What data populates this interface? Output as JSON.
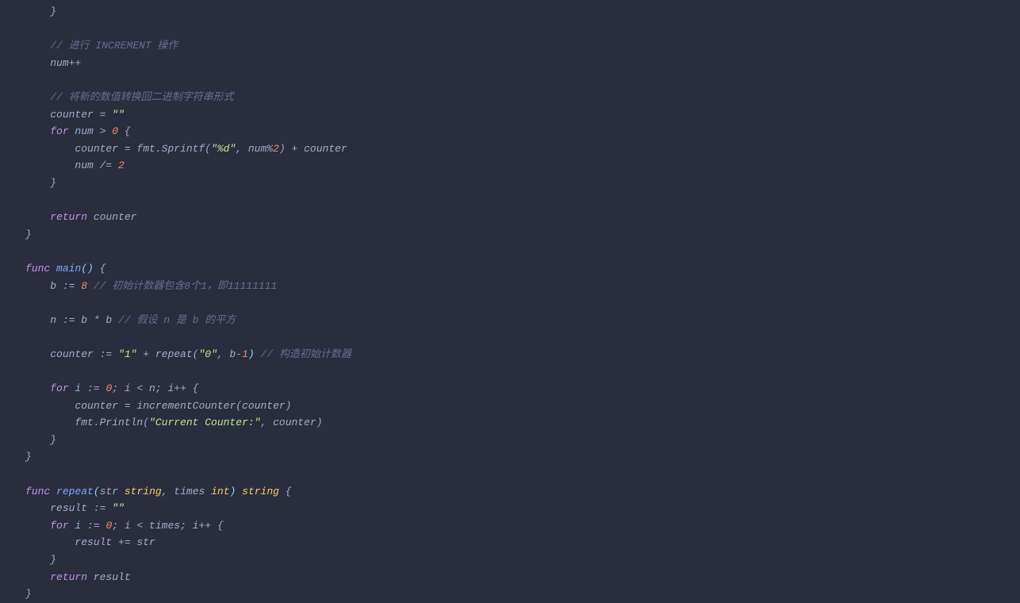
{
  "lines": [
    {
      "indent": 1,
      "tokens": [
        {
          "t": "}",
          "c": "default"
        }
      ]
    },
    {
      "indent": 0,
      "tokens": []
    },
    {
      "indent": 1,
      "tokens": [
        {
          "t": "// 进行 INCREMENT 操作",
          "c": "comment"
        }
      ]
    },
    {
      "indent": 1,
      "tokens": [
        {
          "t": "num++",
          "c": "default"
        }
      ]
    },
    {
      "indent": 0,
      "tokens": []
    },
    {
      "indent": 1,
      "tokens": [
        {
          "t": "// 将新的数值转换回二进制字符串形式",
          "c": "comment"
        }
      ]
    },
    {
      "indent": 1,
      "tokens": [
        {
          "t": "counter = ",
          "c": "default"
        },
        {
          "t": "\"\"",
          "c": "string"
        }
      ]
    },
    {
      "indent": 1,
      "tokens": [
        {
          "t": "for",
          "c": "keyword"
        },
        {
          "t": " num > ",
          "c": "default"
        },
        {
          "t": "0",
          "c": "number"
        },
        {
          "t": " {",
          "c": "default"
        }
      ]
    },
    {
      "indent": 2,
      "tokens": [
        {
          "t": "counter = fmt.Sprintf(",
          "c": "default"
        },
        {
          "t": "\"%d\"",
          "c": "string"
        },
        {
          "t": ", num%",
          "c": "default"
        },
        {
          "t": "2",
          "c": "number"
        },
        {
          "t": ") + counter",
          "c": "default"
        }
      ]
    },
    {
      "indent": 2,
      "tokens": [
        {
          "t": "num /= ",
          "c": "default"
        },
        {
          "t": "2",
          "c": "number"
        }
      ]
    },
    {
      "indent": 1,
      "tokens": [
        {
          "t": "}",
          "c": "default"
        }
      ]
    },
    {
      "indent": 0,
      "tokens": []
    },
    {
      "indent": 1,
      "tokens": [
        {
          "t": "return",
          "c": "keyword"
        },
        {
          "t": " counter",
          "c": "default"
        }
      ]
    },
    {
      "indent": 0,
      "tokens": [
        {
          "t": "}",
          "c": "default"
        }
      ]
    },
    {
      "indent": 0,
      "tokens": []
    },
    {
      "indent": 0,
      "tokens": [
        {
          "t": "func",
          "c": "keyword"
        },
        {
          "t": " ",
          "c": "default"
        },
        {
          "t": "main",
          "c": "funcdecl"
        },
        {
          "t": "()",
          "c": "paren"
        },
        {
          "t": " {",
          "c": "default"
        }
      ]
    },
    {
      "indent": 1,
      "tokens": [
        {
          "t": "b := ",
          "c": "default"
        },
        {
          "t": "8",
          "c": "number"
        },
        {
          "t": " ",
          "c": "default"
        },
        {
          "t": "// 初始计数器包含8个1，即11111111",
          "c": "comment"
        }
      ]
    },
    {
      "indent": 0,
      "tokens": []
    },
    {
      "indent": 1,
      "tokens": [
        {
          "t": "n := b * b ",
          "c": "default"
        },
        {
          "t": "// 假设 n 是 b 的平方",
          "c": "comment"
        }
      ]
    },
    {
      "indent": 0,
      "tokens": []
    },
    {
      "indent": 1,
      "tokens": [
        {
          "t": "counter := ",
          "c": "default"
        },
        {
          "t": "\"1\"",
          "c": "string"
        },
        {
          "t": " + repeat(",
          "c": "default"
        },
        {
          "t": "\"0\"",
          "c": "string"
        },
        {
          "t": ", b-",
          "c": "default"
        },
        {
          "t": "1",
          "c": "number"
        },
        {
          "t": ")",
          "c": "paren"
        },
        {
          "t": " ",
          "c": "default"
        },
        {
          "t": "// 构造初始计数器",
          "c": "comment"
        }
      ]
    },
    {
      "indent": 0,
      "tokens": []
    },
    {
      "indent": 1,
      "tokens": [
        {
          "t": "for",
          "c": "keyword"
        },
        {
          "t": " i := ",
          "c": "default"
        },
        {
          "t": "0",
          "c": "number"
        },
        {
          "t": "; i < n; i++ {",
          "c": "default"
        }
      ]
    },
    {
      "indent": 2,
      "tokens": [
        {
          "t": "counter = incrementCounter(counter)",
          "c": "default"
        }
      ]
    },
    {
      "indent": 2,
      "tokens": [
        {
          "t": "fmt.Println(",
          "c": "default"
        },
        {
          "t": "\"Current Counter:\"",
          "c": "string"
        },
        {
          "t": ", counter)",
          "c": "default"
        }
      ]
    },
    {
      "indent": 1,
      "tokens": [
        {
          "t": "}",
          "c": "default"
        }
      ]
    },
    {
      "indent": 0,
      "tokens": [
        {
          "t": "}",
          "c": "default"
        }
      ]
    },
    {
      "indent": 0,
      "tokens": []
    },
    {
      "indent": 0,
      "tokens": [
        {
          "t": "func",
          "c": "keyword"
        },
        {
          "t": " ",
          "c": "default"
        },
        {
          "t": "repeat",
          "c": "funcdecl"
        },
        {
          "t": "(",
          "c": "paren"
        },
        {
          "t": "str",
          "c": "default"
        },
        {
          "t": " ",
          "c": "default"
        },
        {
          "t": "string",
          "c": "type"
        },
        {
          "t": ", ",
          "c": "default"
        },
        {
          "t": "times",
          "c": "default"
        },
        {
          "t": " ",
          "c": "default"
        },
        {
          "t": "int",
          "c": "type"
        },
        {
          "t": ")",
          "c": "paren"
        },
        {
          "t": " ",
          "c": "default"
        },
        {
          "t": "string",
          "c": "type"
        },
        {
          "t": " {",
          "c": "default"
        }
      ]
    },
    {
      "indent": 1,
      "tokens": [
        {
          "t": "result := ",
          "c": "default"
        },
        {
          "t": "\"\"",
          "c": "string"
        }
      ]
    },
    {
      "indent": 1,
      "tokens": [
        {
          "t": "for",
          "c": "keyword"
        },
        {
          "t": " i := ",
          "c": "default"
        },
        {
          "t": "0",
          "c": "number"
        },
        {
          "t": "; i < times; i++ {",
          "c": "default"
        }
      ]
    },
    {
      "indent": 2,
      "tokens": [
        {
          "t": "result += str",
          "c": "default"
        }
      ]
    },
    {
      "indent": 1,
      "tokens": [
        {
          "t": "}",
          "c": "default"
        }
      ]
    },
    {
      "indent": 1,
      "tokens": [
        {
          "t": "return",
          "c": "keyword"
        },
        {
          "t": " result",
          "c": "default"
        }
      ]
    },
    {
      "indent": 0,
      "tokens": [
        {
          "t": "}",
          "c": "default"
        }
      ]
    }
  ],
  "indentUnit": "    "
}
